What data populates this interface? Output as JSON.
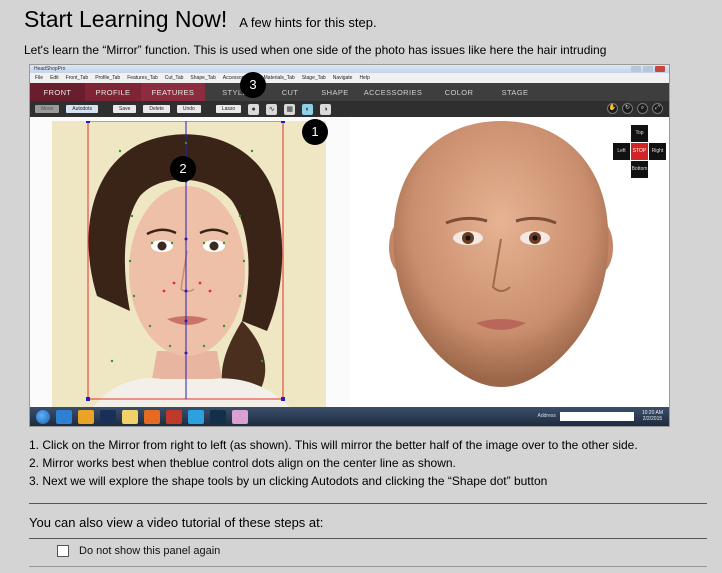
{
  "header": {
    "title": "Start Learning Now!",
    "subtitle": "A few hints for this step."
  },
  "intro": "Let's learn the “Mirror” function. This is used when one side of the photo has issues like here the hair intruding",
  "app": {
    "window_title": "HeadShopPro",
    "menu": [
      "File",
      "Edit",
      "Front_Tab",
      "Profile_Tab",
      "Features_Tab",
      "Cut_Tab",
      "Shape_Tab",
      "Accessory_Tab",
      "Materials_Tab",
      "Stage_Tab",
      "Navigate",
      "Help"
    ],
    "tabs": {
      "front": "Front",
      "profile": "Profile",
      "features": "Features",
      "style": "Style",
      "cut": "Cut",
      "shape": "Shape",
      "accessories": "Accessories",
      "color": "Color",
      "stage": "Stage"
    },
    "toolbar": {
      "move": "Move",
      "autodots": "Autodots",
      "save": "Save",
      "delete": "Delete",
      "undo": "Undo",
      "lasso": "Lasso"
    },
    "dpad": {
      "top": "Top",
      "left": "Left",
      "stop": "STOP",
      "right": "Right",
      "bottom": "Bottom"
    },
    "taskbar": {
      "address_label": "Address",
      "time": "10:20 AM",
      "date": "2/2/2015"
    }
  },
  "badges": {
    "one": "1",
    "two": "2",
    "three": "3"
  },
  "steps": [
    "1. Click on the Mirror from right to left (as shown). This will mirror the better half of the image over to the other side.",
    "2. Mirror works best when theblue control dots align on the center line as shown.",
    "3. Next we will explore the shape tools by un clicking Autodots and clicking the “Shape dot” button"
  ],
  "video_text": "You can also view a video tutorial of these steps at:",
  "checkbox_label": "Do not show this panel again",
  "colors": {
    "background": "#d4d4d4",
    "tab_active": "#8e2c3f",
    "stop": "#d12525",
    "guide_red": "#e4302f",
    "guide_blue": "#2020c0"
  }
}
